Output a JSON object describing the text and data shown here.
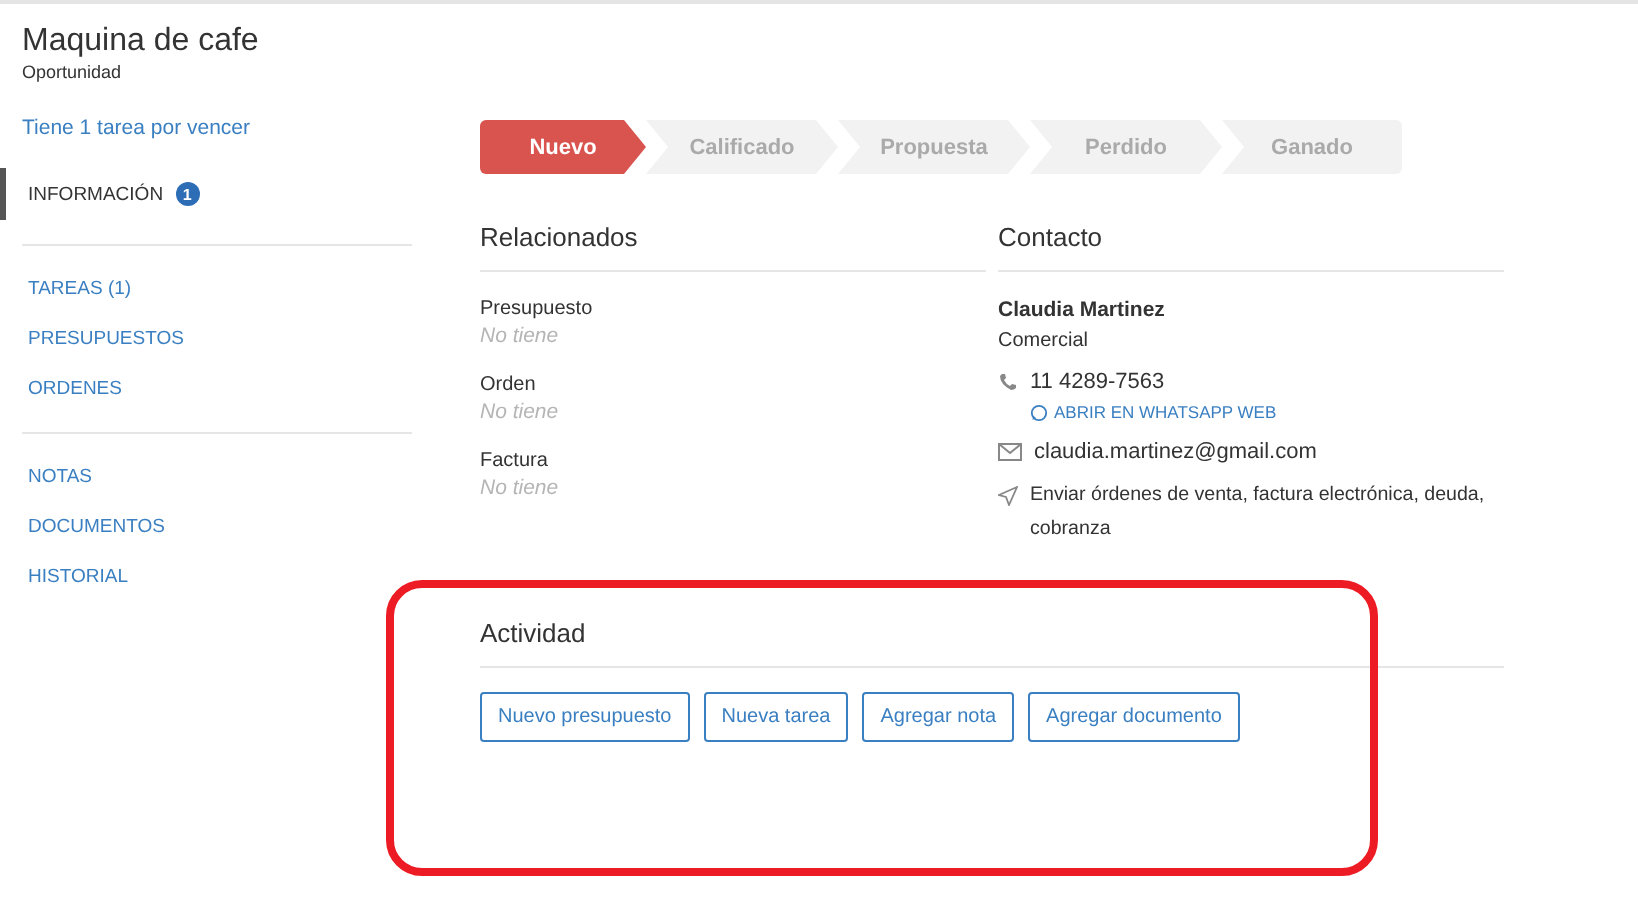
{
  "header": {
    "title": "Maquina de cafe",
    "subtitle": "Oportunidad"
  },
  "sidebar": {
    "alert": "Tiene 1 tarea por vencer",
    "groups": [
      [
        {
          "label": "INFORMACIÓN",
          "badge": "1",
          "selected": true
        }
      ],
      [
        {
          "label": "TAREAS (1)",
          "selected": false
        },
        {
          "label": "PRESUPUESTOS",
          "selected": false
        },
        {
          "label": "ORDENES",
          "selected": false
        }
      ],
      [
        {
          "label": "NOTAS",
          "selected": false
        },
        {
          "label": "DOCUMENTOS",
          "selected": false
        },
        {
          "label": "HISTORIAL",
          "selected": false
        }
      ]
    ]
  },
  "stages": [
    {
      "label": "Nuevo",
      "selected": true
    },
    {
      "label": "Calificado",
      "selected": false
    },
    {
      "label": "Propuesta",
      "selected": false
    },
    {
      "label": "Perdido",
      "selected": false
    },
    {
      "label": "Ganado",
      "selected": false
    }
  ],
  "related": {
    "heading": "Relacionados",
    "fields": [
      {
        "label": "Presupuesto",
        "value": "No tiene"
      },
      {
        "label": "Orden",
        "value": "No tiene"
      },
      {
        "label": "Factura",
        "value": "No tiene"
      }
    ]
  },
  "contact": {
    "heading": "Contacto",
    "name": "Claudia Martinez",
    "role": "Comercial",
    "phone": "11 4289-7563",
    "whatsapp": "ABRIR EN WHATSAPP WEB",
    "email": "claudia.martinez@gmail.com",
    "sends": "Enviar órdenes de venta, factura electrónica, deuda, cobranza"
  },
  "activity": {
    "heading": "Actividad",
    "buttons": [
      "Nuevo presupuesto",
      "Nueva tarea",
      "Agregar nota",
      "Agregar documento"
    ]
  }
}
